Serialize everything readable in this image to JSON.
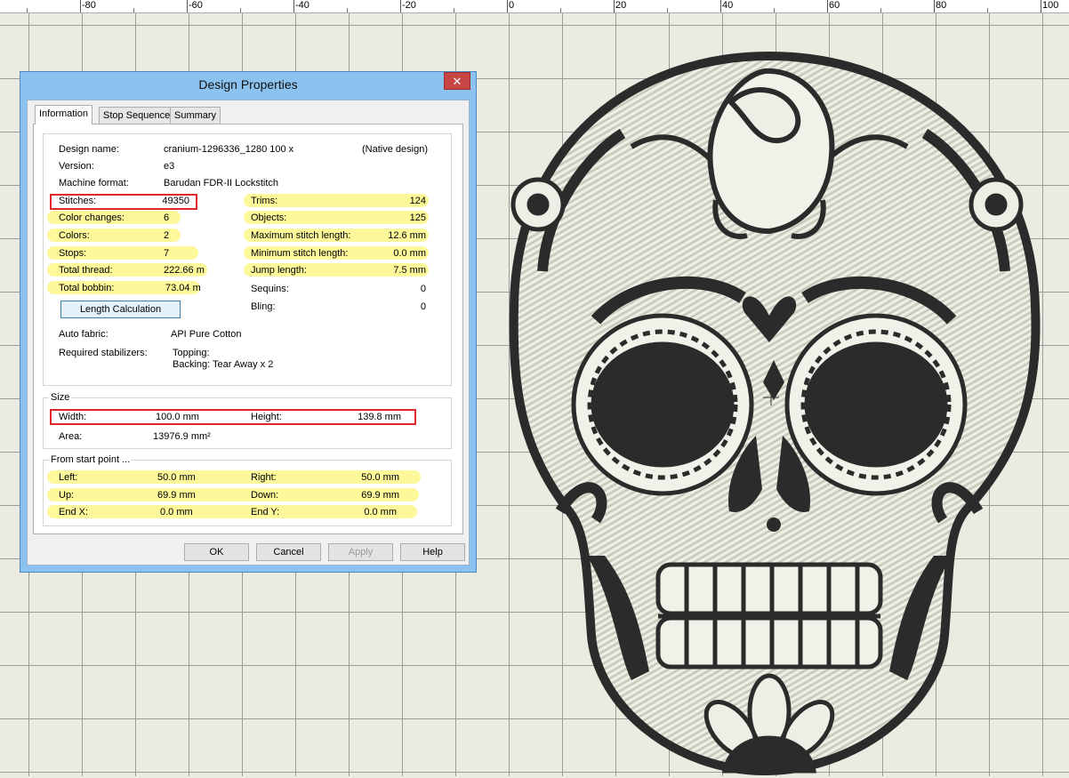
{
  "ruler": {
    "labels": [
      "-80",
      "-60",
      "-40",
      "-20",
      "0",
      "20",
      "40",
      "60",
      "80",
      "100"
    ]
  },
  "dialog": {
    "title": "Design Properties",
    "close_glyph": "✕",
    "tabs": [
      "Information",
      "Stop Sequence",
      "Summary"
    ],
    "info": {
      "design_name_label": "Design name:",
      "design_name": "cranium-1296336_1280 100 x",
      "design_tag": "(Native design)",
      "version_label": "Version:",
      "version": "e3",
      "machine_label": "Machine format:",
      "machine": "Barudan FDR-II Lockstitch",
      "stitches_label": "Stitches:",
      "stitches": "49350",
      "color_changes_label": "Color changes:",
      "color_changes": "6",
      "colors_label": "Colors:",
      "colors": "2",
      "stops_label": "Stops:",
      "stops": "7",
      "total_thread_label": "Total thread:",
      "total_thread": "222.66 m",
      "total_bobbin_label": "Total bobbin:",
      "total_bobbin": "73.04 m",
      "trims_label": "Trims:",
      "trims": "124",
      "objects_label": "Objects:",
      "objects": "125",
      "max_stitch_label": "Maximum stitch length:",
      "max_stitch": "12.6 mm",
      "min_stitch_label": "Minimum stitch length:",
      "min_stitch": "0.0 mm",
      "jump_label": "Jump length:",
      "jump": "7.5 mm",
      "sequins_label": "Sequins:",
      "sequins": "0",
      "bling_label": "Bling:",
      "bling": "0",
      "length_button": "Length Calculation",
      "auto_fabric_label": "Auto fabric:",
      "auto_fabric": "API Pure Cotton",
      "stabilizers_label": "Required stabilizers:",
      "stab_topping": "Topping:",
      "stab_backing": "Backing: Tear Away x 2"
    },
    "size": {
      "title": "Size",
      "width_label": "Width:",
      "width": "100.0 mm",
      "height_label": "Height:",
      "height": "139.8 mm",
      "area_label": "Area:",
      "area": "13976.9 mm²"
    },
    "start": {
      "title": "From start point ...",
      "left_label": "Left:",
      "left": "50.0 mm",
      "right_label": "Right:",
      "right": "50.0 mm",
      "up_label": "Up:",
      "up": "69.9 mm",
      "down_label": "Down:",
      "down": "69.9 mm",
      "endx_label": "End X:",
      "endx": "0.0 mm",
      "endy_label": "End Y:",
      "endy": "0.0 mm"
    },
    "buttons": {
      "ok": "OK",
      "cancel": "Cancel",
      "apply": "Apply",
      "help": "Help"
    }
  }
}
